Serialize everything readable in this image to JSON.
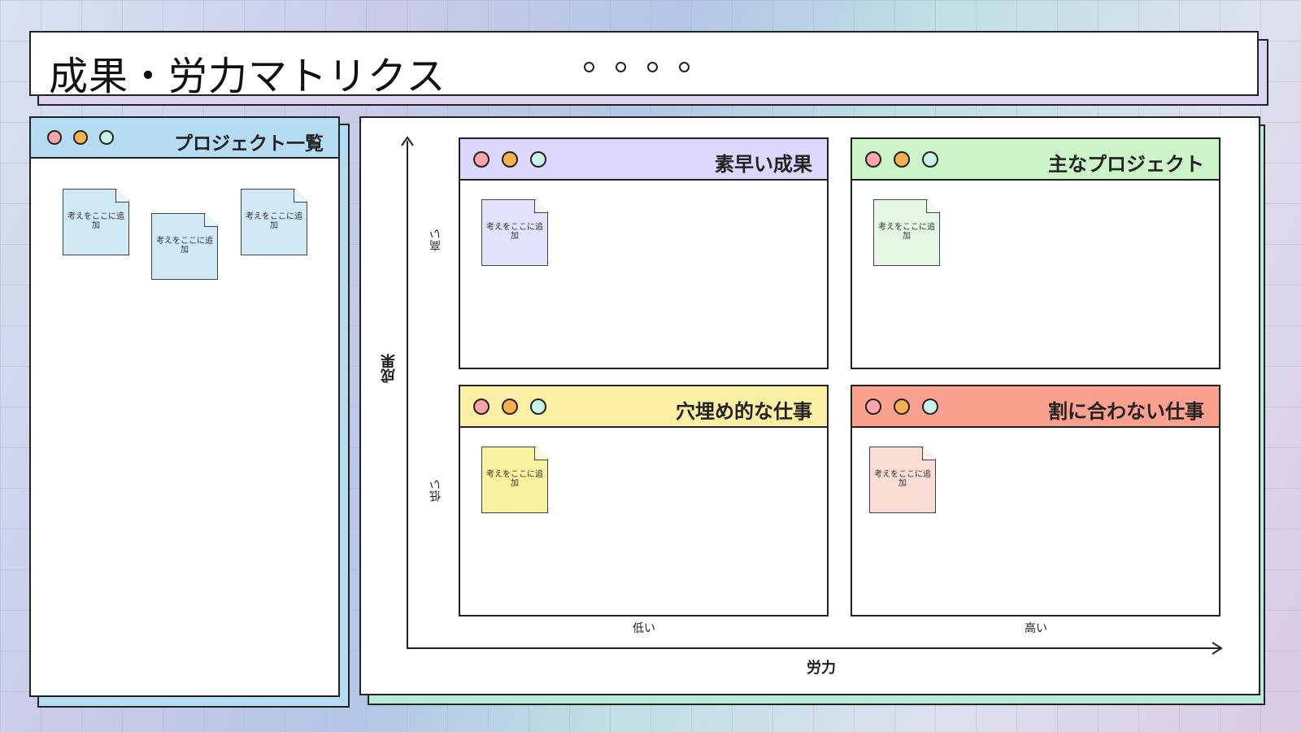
{
  "title": "成果・労力マトリクス",
  "colors": {
    "title_shadow": "#ddd5f3",
    "list_header": "#b6dcf3",
    "board_shadow": "#b9e9d8",
    "dot_red": "#f7a5a8",
    "dot_orange": "#f5b14f",
    "dot_cyan": "#c9f2ec"
  },
  "project_list": {
    "title": "プロジェクト一覧",
    "header_color": "#b6dcf3",
    "notes": [
      {
        "text": "考えをここに追加",
        "color": "#cfe9f7"
      },
      {
        "text": "考えをここに追加",
        "color": "#cfe9f7"
      },
      {
        "text": "考えをここに追加",
        "color": "#cfe9f7"
      }
    ]
  },
  "matrix": {
    "y_axis_label": "成果",
    "x_axis_label": "労力",
    "y_high": "高い",
    "y_low": "低い",
    "x_low": "低い",
    "x_high": "高い",
    "quadrants": [
      {
        "title": "素早い成果",
        "header_color": "#dcd8fb",
        "note": {
          "text": "考えをここに追加",
          "color": "#e2e2fb"
        }
      },
      {
        "title": "主なプロジェクト",
        "header_color": "#cdf3c9",
        "note": {
          "text": "考えをここに追加",
          "color": "#e3f7e2"
        }
      },
      {
        "title": "穴埋め的な仕事",
        "header_color": "#fbeea5",
        "note": {
          "text": "考えをここに追加",
          "color": "#fbf2a0"
        }
      },
      {
        "title": "割に合わない仕事",
        "header_color": "#f9a18e",
        "note": {
          "text": "考えをここに追加",
          "color": "#fbddd5"
        }
      }
    ]
  }
}
